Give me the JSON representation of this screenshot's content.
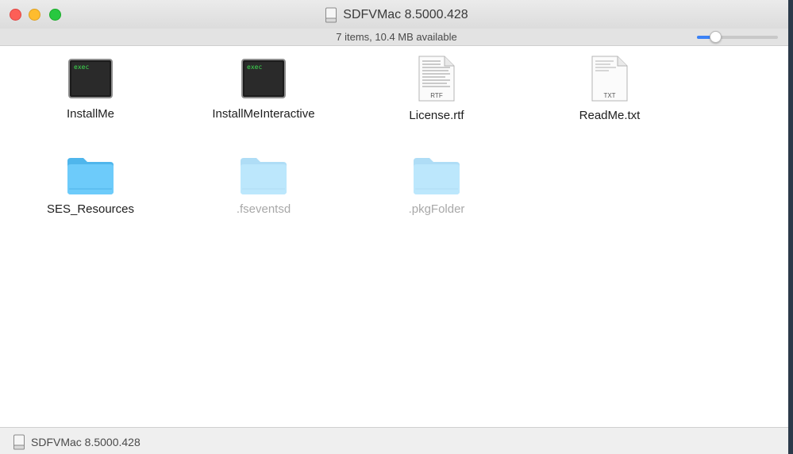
{
  "window": {
    "title": "SDFVMac 8.5000.428"
  },
  "status": {
    "text": "7 items, 10.4 MB available",
    "zoom_fraction": 0.18
  },
  "items": [
    {
      "name": "InstallMe",
      "kind": "exec",
      "icon_text": "exec"
    },
    {
      "name": "InstallMeInteractive",
      "kind": "exec",
      "icon_text": "exec"
    },
    {
      "name": "License.rtf",
      "kind": "doc",
      "icon_text": "RTF"
    },
    {
      "name": "ReadMe.txt",
      "kind": "doc",
      "icon_text": "TXT"
    },
    {
      "name": "SES_Resources",
      "kind": "folder"
    },
    {
      "name": ".fseventsd",
      "kind": "folder",
      "hidden": true
    },
    {
      "name": ".pkgFolder",
      "kind": "folder",
      "hidden": true
    }
  ],
  "pathbar": {
    "text": "SDFVMac 8.5000.428"
  },
  "colors": {
    "folder": "#5ac6f8",
    "accent": "#3b82f6",
    "terminal_text": "#3ddc50"
  }
}
